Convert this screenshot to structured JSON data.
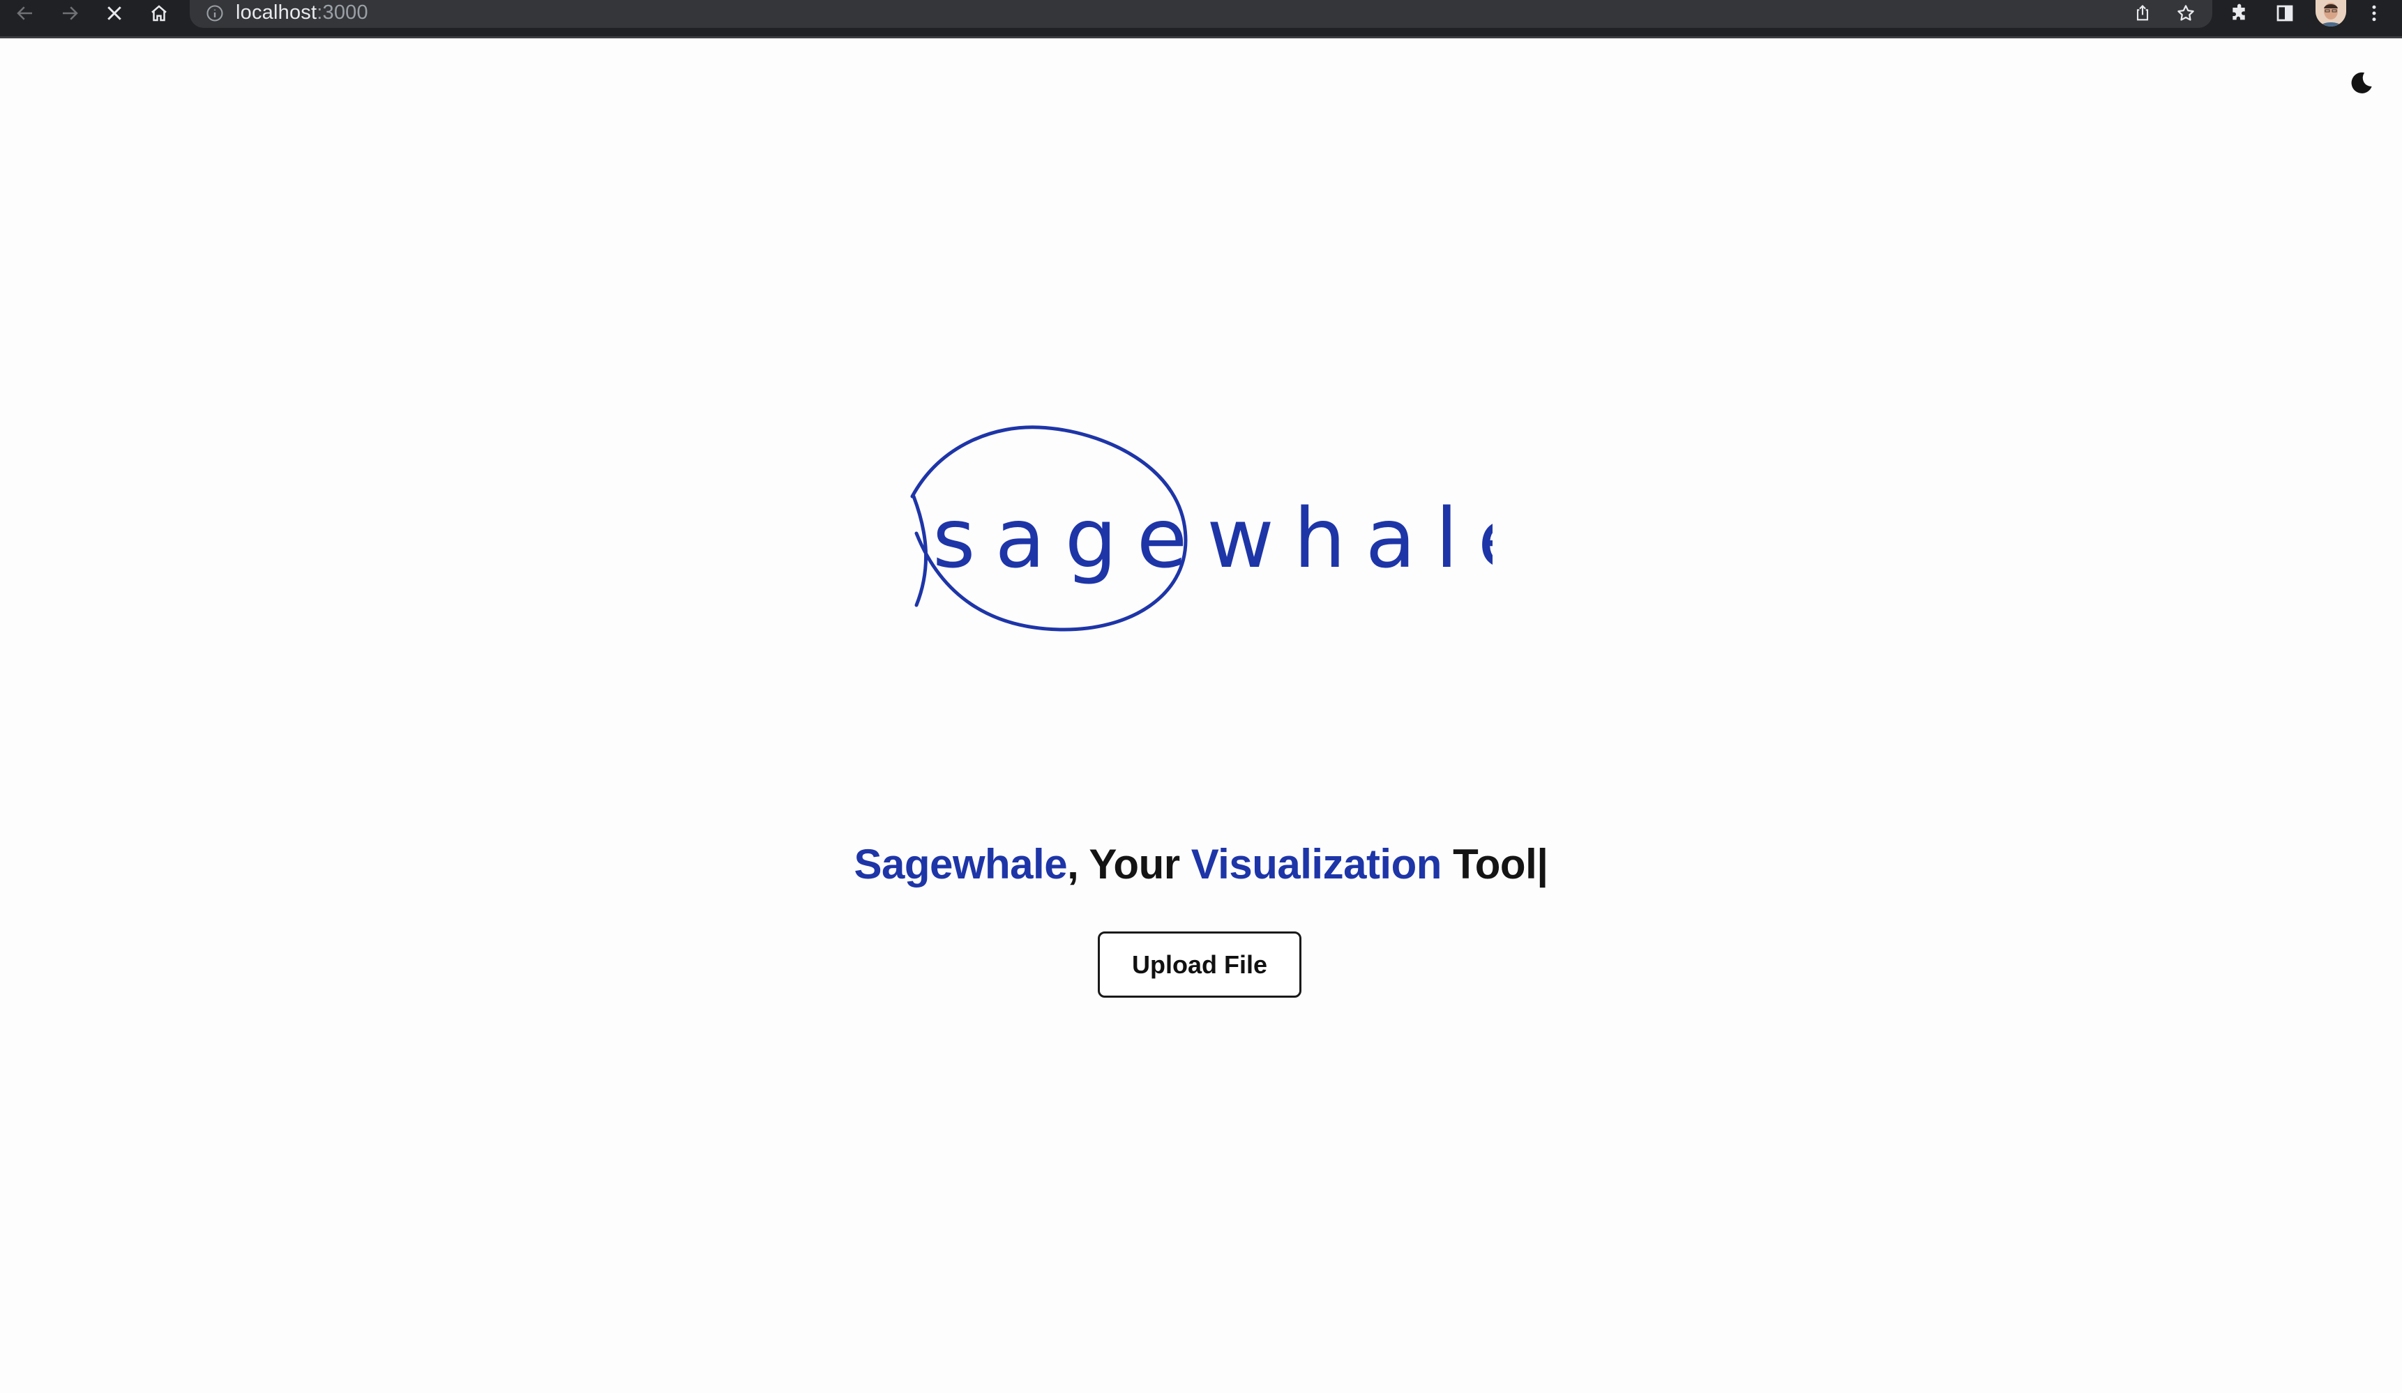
{
  "browser": {
    "url_host": "localhost",
    "url_port": ":3000",
    "icons": [
      "back-arrow-icon",
      "forward-arrow-icon",
      "stop-loading-icon",
      "home-icon",
      "info-icon",
      "share-icon",
      "star-icon",
      "extensions-icon",
      "side-panel-icon",
      "profile-avatar",
      "more-menu-icon"
    ]
  },
  "page": {
    "theme_toggle_icon": "moon-icon",
    "logo_text": "sagewhale",
    "headline": {
      "brand": "Sagewhale",
      "sep": ", Your ",
      "highlight": "Visualization",
      "tail": " Tool",
      "cursor": "|"
    },
    "upload_label": "Upload File"
  },
  "colors": {
    "brand_blue": "#1e35a8",
    "chrome_bg": "#202124",
    "page_bg": "#fdfdfd"
  }
}
